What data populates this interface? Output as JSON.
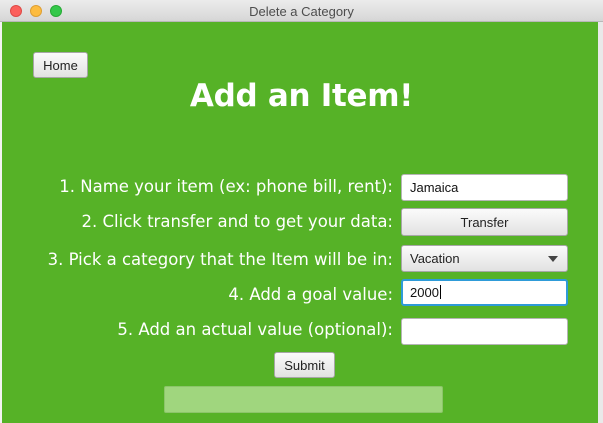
{
  "window": {
    "title": "Delete a Category"
  },
  "home_button": {
    "label": "Home"
  },
  "heading": "Add an Item!",
  "form": {
    "name_label": "1. Name your item (ex: phone bill, rent):",
    "name_value": "Jamaica",
    "transfer_label": "2. Click transfer and to get your data:",
    "transfer_button": "Transfer",
    "category_label": "3. Pick a category that the Item will be in:",
    "category_value": "Vacation",
    "goal_label": "4. Add a goal value:",
    "goal_value": "2000",
    "actual_label": "5. Add an actual value (optional):",
    "actual_value": "",
    "submit_button": "Submit"
  },
  "colors": {
    "background": "#56b227",
    "focus": "#2e9bd8"
  }
}
